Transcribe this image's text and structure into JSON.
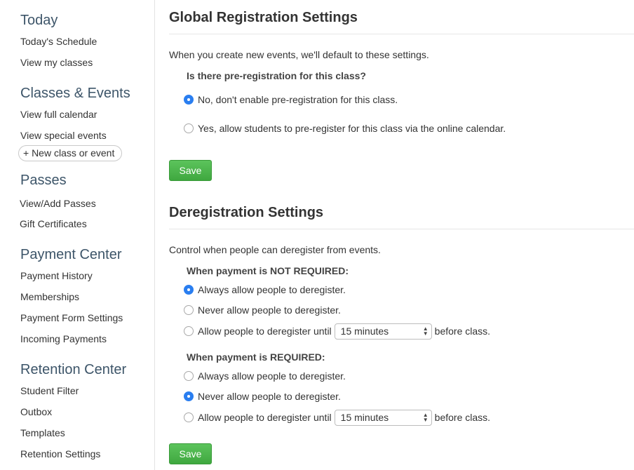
{
  "sidebar": {
    "sections": [
      {
        "title": "Today",
        "items": [
          "Today's Schedule",
          "View my classes"
        ]
      },
      {
        "title": "Classes & Events",
        "items": [
          "View full calendar",
          "View special events"
        ],
        "button": "+ New class or event"
      },
      {
        "title": "Passes",
        "items": [
          "View/Add Passes",
          "Gift Certificates"
        ]
      },
      {
        "title": "Payment Center",
        "items": [
          "Payment History",
          "Memberships",
          "Payment Form Settings",
          "Incoming Payments"
        ]
      },
      {
        "title": "Retention Center",
        "items": [
          "Student Filter",
          "Outbox",
          "Templates",
          "Retention Settings"
        ]
      }
    ]
  },
  "global": {
    "title": "Global Registration Settings",
    "description": "When you create new events, we'll default to these settings.",
    "question": "Is there pre-registration for this class?",
    "options": [
      {
        "label": "No, don't enable pre-registration for this class.",
        "checked": true
      },
      {
        "label": "Yes, allow students to pre-register for this class via the online calendar.",
        "checked": false
      }
    ],
    "save_label": "Save"
  },
  "dereg": {
    "title": "Deregistration Settings",
    "description": "Control when people can deregister from events.",
    "not_required": {
      "label": "When payment is NOT REQUIRED:",
      "options": [
        {
          "label": "Always allow people to deregister.",
          "checked": true
        },
        {
          "label": "Never allow people to deregister.",
          "checked": false
        },
        {
          "label": "Allow people to deregister until",
          "checked": false
        }
      ],
      "select_value": "15 minutes",
      "suffix": "before class."
    },
    "required": {
      "label": "When payment is REQUIRED:",
      "options": [
        {
          "label": "Always allow people to deregister.",
          "checked": false
        },
        {
          "label": "Never allow people to deregister.",
          "checked": true
        },
        {
          "label": "Allow people to deregister until",
          "checked": false
        }
      ],
      "select_value": "15 minutes",
      "suffix": "before class."
    },
    "save_label": "Save"
  }
}
